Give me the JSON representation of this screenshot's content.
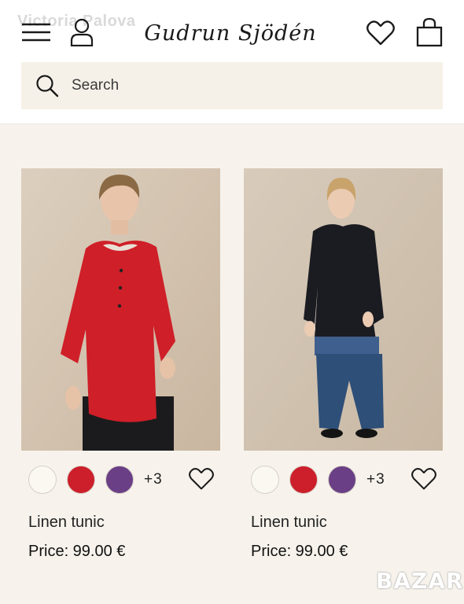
{
  "watermark_top": "Victoria Palova",
  "header": {
    "logo_text": "Gudrun Sjödén",
    "icons": {
      "menu": "hamburger-menu-icon",
      "user": "user-icon",
      "favorites": "heart-icon",
      "bag": "shopping-bag-icon"
    }
  },
  "search": {
    "placeholder": "Search",
    "icon": "search-icon"
  },
  "products": [
    {
      "name": "Linen tunic",
      "price": "Price: 99.00 €",
      "more_colors": "+3",
      "swatches": [
        "#fbf8f2",
        "#cc1f2b",
        "#6a3f86"
      ],
      "tunic_color": "#cf1f28"
    },
    {
      "name": "Linen tunic",
      "price": "Price: 99.00 €",
      "more_colors": "+3",
      "swatches": [
        "#fbf8f2",
        "#cc1f2b",
        "#6a3f86"
      ],
      "tunic_color": "#1b1c22"
    }
  ],
  "badge_text": "BAZAR",
  "colors": {
    "page_bg": "#f7f3ec",
    "header_bg": "#ffffff",
    "search_bg": "#f6f1e8"
  }
}
